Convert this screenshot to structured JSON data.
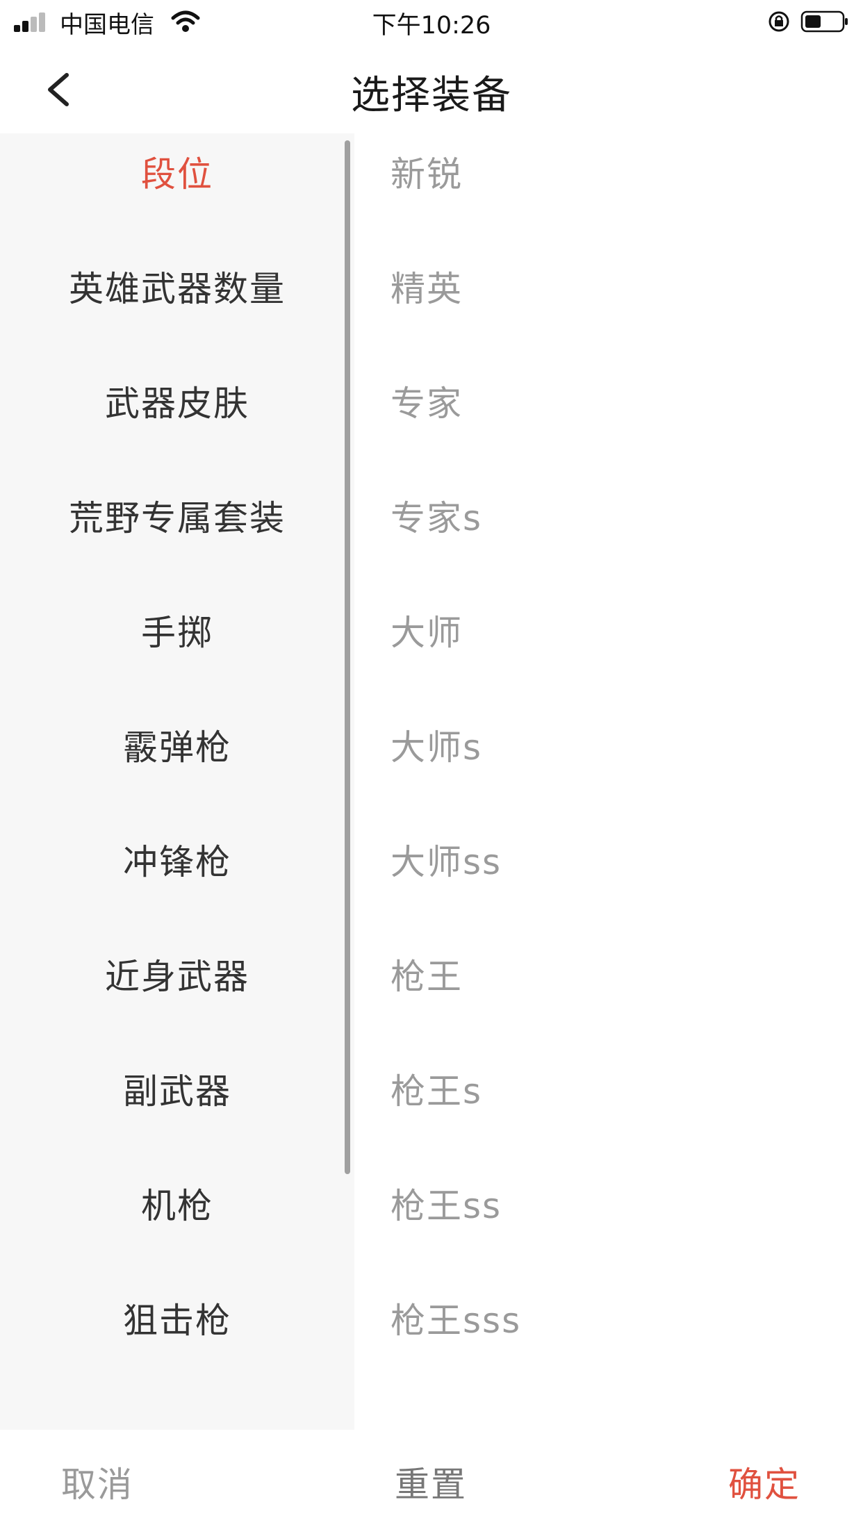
{
  "status_bar": {
    "carrier": "中国电信",
    "time": "下午10:26"
  },
  "nav": {
    "title": "选择装备"
  },
  "categories": [
    {
      "label": "段位",
      "active": true
    },
    {
      "label": "英雄武器数量"
    },
    {
      "label": "武器皮肤"
    },
    {
      "label": "荒野专属套装"
    },
    {
      "label": "手掷"
    },
    {
      "label": "霰弹枪"
    },
    {
      "label": "冲锋枪"
    },
    {
      "label": "近身武器"
    },
    {
      "label": "副武器"
    },
    {
      "label": "机枪"
    },
    {
      "label": "狙击枪"
    }
  ],
  "options": [
    {
      "label": "新锐"
    },
    {
      "label": "精英"
    },
    {
      "label": "专家"
    },
    {
      "label": "专家s"
    },
    {
      "label": "大师"
    },
    {
      "label": "大师s"
    },
    {
      "label": "大师ss"
    },
    {
      "label": "枪王"
    },
    {
      "label": "枪王s"
    },
    {
      "label": "枪王ss"
    },
    {
      "label": "枪王sss"
    }
  ],
  "bottom": {
    "cancel": "取消",
    "reset": "重置",
    "confirm": "确定"
  },
  "colors": {
    "accent": "#e0513f",
    "muted": "#9a9a9a",
    "panel_bg": "#f7f7f7"
  }
}
